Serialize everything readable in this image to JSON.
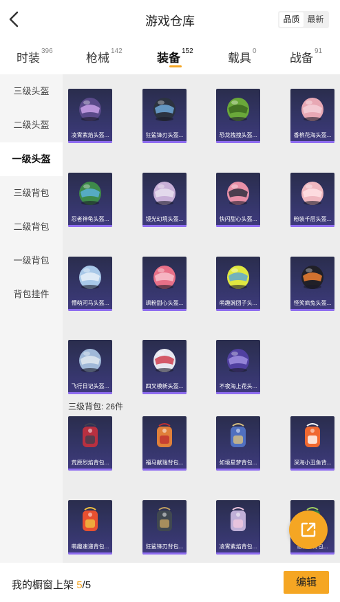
{
  "header": {
    "title": "游戏仓库",
    "back_icon": "chevron-left-icon",
    "sort_options": [
      "品质",
      "最新"
    ],
    "sort_selected": "品质"
  },
  "tabs": [
    {
      "label": "时装",
      "count": "396",
      "active": false
    },
    {
      "label": "枪械",
      "count": "142",
      "active": false
    },
    {
      "label": "装备",
      "count": "152",
      "active": true
    },
    {
      "label": "载具",
      "count": "0",
      "active": false
    },
    {
      "label": "战备",
      "count": "91",
      "active": false
    }
  ],
  "sidebar": {
    "items": [
      {
        "label": "三级头盔",
        "active": false
      },
      {
        "label": "二级头盔",
        "active": false
      },
      {
        "label": "一级头盔",
        "active": true
      },
      {
        "label": "三级背包",
        "active": false
      },
      {
        "label": "二级背包",
        "active": false
      },
      {
        "label": "一级背包",
        "active": false
      },
      {
        "label": "背包挂件",
        "active": false
      }
    ]
  },
  "helmets": [
    {
      "name": "凌霄紫焰头盔...",
      "color": "#5a4a8a",
      "accent": "#c9a0e8"
    },
    {
      "name": "狂鲨锋刃头盔...",
      "color": "#2c3340",
      "accent": "#6fa8d8"
    },
    {
      "name": "恐龙拽拽头盔...",
      "color": "#6aa83a",
      "accent": "#3c6a20"
    },
    {
      "name": "香槟花海头盔...",
      "color": "#e8a8b4",
      "accent": "#f5d0d8"
    },
    {
      "name": "忍者神龟头盔...",
      "color": "#3e8a4a",
      "accent": "#5ab0d8"
    },
    {
      "name": "镜光幻境头盔...",
      "color": "#c8b0d8",
      "accent": "#e8e0f0"
    },
    {
      "name": "快闪甜心头盔...",
      "color": "#e890a8",
      "accent": "#303040"
    },
    {
      "name": "粉装千层头盔...",
      "color": "#f0b8c0",
      "accent": "#ffe0e4"
    },
    {
      "name": "懵萌河马头盔...",
      "color": "#a8c8e8",
      "accent": "#e8f0f8"
    },
    {
      "name": "飒粉甜心头盔...",
      "color": "#e87088",
      "accent": "#f8c0cc"
    },
    {
      "name": "萌趣豌团子头...",
      "color": "#e0e840",
      "accent": "#60a8d0"
    },
    {
      "name": "怪笑疯兔头盔...",
      "color": "#202028",
      "accent": "#f08030"
    },
    {
      "name": "飞行日记头盔...",
      "color": "#a0b8d8",
      "accent": "#e0e8f0"
    },
    {
      "name": "四叉模新头盔...",
      "color": "#e8e8f0",
      "accent": "#d04050"
    },
    {
      "name": "不夜海上花头...",
      "color": "#5040a0",
      "accent": "#a090e0"
    }
  ],
  "backpack_section": {
    "title": "三级背包: 26件"
  },
  "backpacks": [
    {
      "name": "荒原烈焰背包...",
      "color": "#b83040",
      "accent": "#404050"
    },
    {
      "name": "福马献瑞背包...",
      "color": "#e0803a",
      "accent": "#c03030"
    },
    {
      "name": "如境星梦背包...",
      "color": "#5070c0",
      "accent": "#d8c080"
    },
    {
      "name": "深海小丑鱼背...",
      "color": "#f06830",
      "accent": "#ffffff"
    },
    {
      "name": "萌趣速递背包...",
      "color": "#e85030",
      "accent": "#f0c040"
    },
    {
      "name": "狂鲨锋刃背包...",
      "color": "#404850",
      "accent": "#c0a060"
    },
    {
      "name": "凌霄紫焰背包...",
      "color": "#c0b0d8",
      "accent": "#f0c8e0"
    },
    {
      "name": "恶龙...背包...",
      "color": "#3a8a40",
      "accent": "#a0d060"
    }
  ],
  "fab": {
    "icon": "share-external-icon"
  },
  "footer": {
    "label": "我的橱窗上架",
    "current": "5",
    "total": "/5",
    "edit_label": "编辑"
  }
}
